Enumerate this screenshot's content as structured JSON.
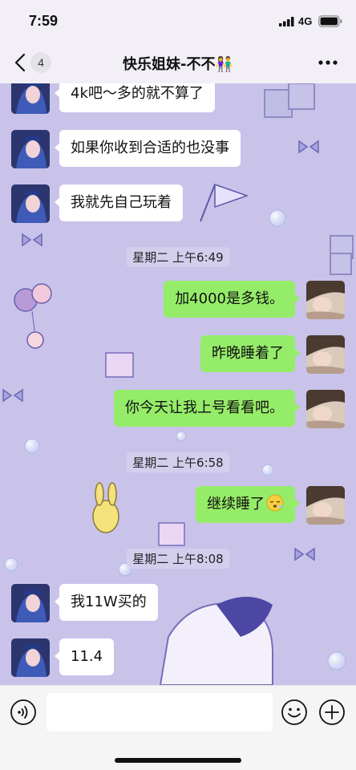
{
  "status_bar": {
    "time": "7:59",
    "network": "4G"
  },
  "nav": {
    "unread_count": "4",
    "title": "快乐姐妹-不不👫",
    "more_icon": "more-dots-icon"
  },
  "messages": [
    {
      "dir": "in",
      "text": "4k吧～多的就不算了"
    },
    {
      "dir": "in",
      "text": "如果你收到合适的也没事"
    },
    {
      "dir": "in",
      "text": "我就先自己玩着"
    },
    {
      "type": "time",
      "text": "星期二 上午6:49"
    },
    {
      "dir": "out",
      "text": "加4000是多钱。"
    },
    {
      "dir": "out",
      "text": "昨晚睡着了"
    },
    {
      "dir": "out",
      "text": "你今天让我上号看看吧。"
    },
    {
      "type": "time",
      "text": "星期二 上午6:58"
    },
    {
      "dir": "out",
      "text": "继续睡了",
      "emoji": "sleepy-face-emoji"
    },
    {
      "type": "time",
      "text": "星期二 上午8:08"
    },
    {
      "dir": "in",
      "text": "我11W买的"
    },
    {
      "dir": "in",
      "text": "11.4"
    }
  ],
  "input": {
    "placeholder": "",
    "voice_icon": "voice-icon",
    "sticker_icon": "sticker-smile-icon",
    "plus_icon": "plus-icon"
  },
  "colors": {
    "chat_background": "#c9c3ea",
    "outgoing_bubble": "#95ec69",
    "incoming_bubble": "#ffffff"
  }
}
